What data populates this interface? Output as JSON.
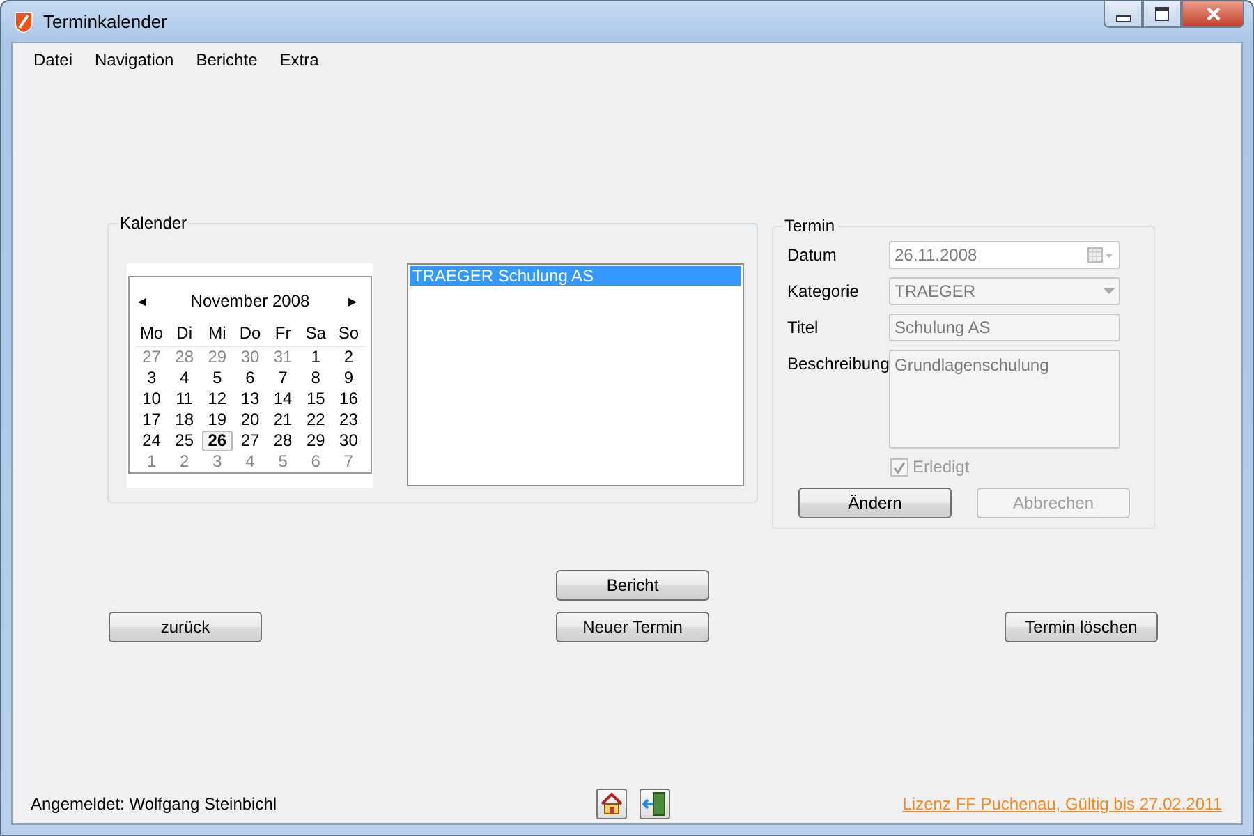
{
  "window": {
    "title": "Terminkalender"
  },
  "menu": [
    {
      "label": "Datei"
    },
    {
      "label": "Navigation"
    },
    {
      "label": "Berichte"
    },
    {
      "label": "Extra"
    }
  ],
  "kalender": {
    "title": "Kalender",
    "month_label": "November 2008",
    "prev": "◂",
    "next": "▸",
    "weekdays": [
      "Mo",
      "Di",
      "Mi",
      "Do",
      "Fr",
      "Sa",
      "So"
    ],
    "weeks": [
      [
        {
          "day": "27",
          "other_month": true,
          "selected": false
        },
        {
          "day": "28",
          "other_month": true,
          "selected": false
        },
        {
          "day": "29",
          "other_month": true,
          "selected": false
        },
        {
          "day": "30",
          "other_month": true,
          "selected": false
        },
        {
          "day": "31",
          "other_month": true,
          "selected": false
        },
        {
          "day": "1",
          "other_month": false,
          "selected": false
        },
        {
          "day": "2",
          "other_month": false,
          "selected": false
        }
      ],
      [
        {
          "day": "3",
          "other_month": false,
          "selected": false
        },
        {
          "day": "4",
          "other_month": false,
          "selected": false
        },
        {
          "day": "5",
          "other_month": false,
          "selected": false
        },
        {
          "day": "6",
          "other_month": false,
          "selected": false
        },
        {
          "day": "7",
          "other_month": false,
          "selected": false
        },
        {
          "day": "8",
          "other_month": false,
          "selected": false
        },
        {
          "day": "9",
          "other_month": false,
          "selected": false
        }
      ],
      [
        {
          "day": "10",
          "other_month": false,
          "selected": false
        },
        {
          "day": "11",
          "other_month": false,
          "selected": false
        },
        {
          "day": "12",
          "other_month": false,
          "selected": false
        },
        {
          "day": "13",
          "other_month": false,
          "selected": false
        },
        {
          "day": "14",
          "other_month": false,
          "selected": false
        },
        {
          "day": "15",
          "other_month": false,
          "selected": false
        },
        {
          "day": "16",
          "other_month": false,
          "selected": false
        }
      ],
      [
        {
          "day": "17",
          "other_month": false,
          "selected": false
        },
        {
          "day": "18",
          "other_month": false,
          "selected": false
        },
        {
          "day": "19",
          "other_month": false,
          "selected": false
        },
        {
          "day": "20",
          "other_month": false,
          "selected": false
        },
        {
          "day": "21",
          "other_month": false,
          "selected": false
        },
        {
          "day": "22",
          "other_month": false,
          "selected": false
        },
        {
          "day": "23",
          "other_month": false,
          "selected": false
        }
      ],
      [
        {
          "day": "24",
          "other_month": false,
          "selected": false
        },
        {
          "day": "25",
          "other_month": false,
          "selected": false
        },
        {
          "day": "26",
          "other_month": false,
          "selected": true
        },
        {
          "day": "27",
          "other_month": false,
          "selected": false
        },
        {
          "day": "28",
          "other_month": false,
          "selected": false
        },
        {
          "day": "29",
          "other_month": false,
          "selected": false
        },
        {
          "day": "30",
          "other_month": false,
          "selected": false
        }
      ],
      [
        {
          "day": "1",
          "other_month": true,
          "selected": false
        },
        {
          "day": "2",
          "other_month": true,
          "selected": false
        },
        {
          "day": "3",
          "other_month": true,
          "selected": false
        },
        {
          "day": "4",
          "other_month": true,
          "selected": false
        },
        {
          "day": "5",
          "other_month": true,
          "selected": false
        },
        {
          "day": "6",
          "other_month": true,
          "selected": false
        },
        {
          "day": "7",
          "other_month": true,
          "selected": false
        }
      ]
    ],
    "appointments": [
      {
        "label": "TRAEGER Schulung AS",
        "selected": true
      }
    ]
  },
  "termin": {
    "title": "Termin",
    "fields": [
      {
        "kind": "date",
        "label": "Datum",
        "value": "26.11.2008",
        "disabled": true
      },
      {
        "kind": "combo",
        "label": "Kategorie",
        "value": "TRAEGER",
        "disabled": true
      },
      {
        "kind": "text",
        "label": "Titel",
        "value": "Schulung AS",
        "disabled": true
      },
      {
        "kind": "memo",
        "label": "Beschreibung",
        "value": "Grundlagenschulung",
        "disabled": true
      }
    ],
    "erledigt": {
      "label": "Erledigt",
      "checked": true,
      "disabled": true
    },
    "buttons": [
      {
        "label": "Ändern",
        "disabled": false
      },
      {
        "label": "Abbrechen",
        "disabled": true
      }
    ]
  },
  "actions": {
    "bericht": "Bericht",
    "zurueck": "zurück",
    "neuer_termin": "Neuer Termin",
    "loeschen": "Termin löschen"
  },
  "status_bar": {
    "user": "Angemeldet: Wolfgang Steinbichl",
    "license": "Lizenz FF Puchenau, Gültig bis 27.02.2011"
  }
}
